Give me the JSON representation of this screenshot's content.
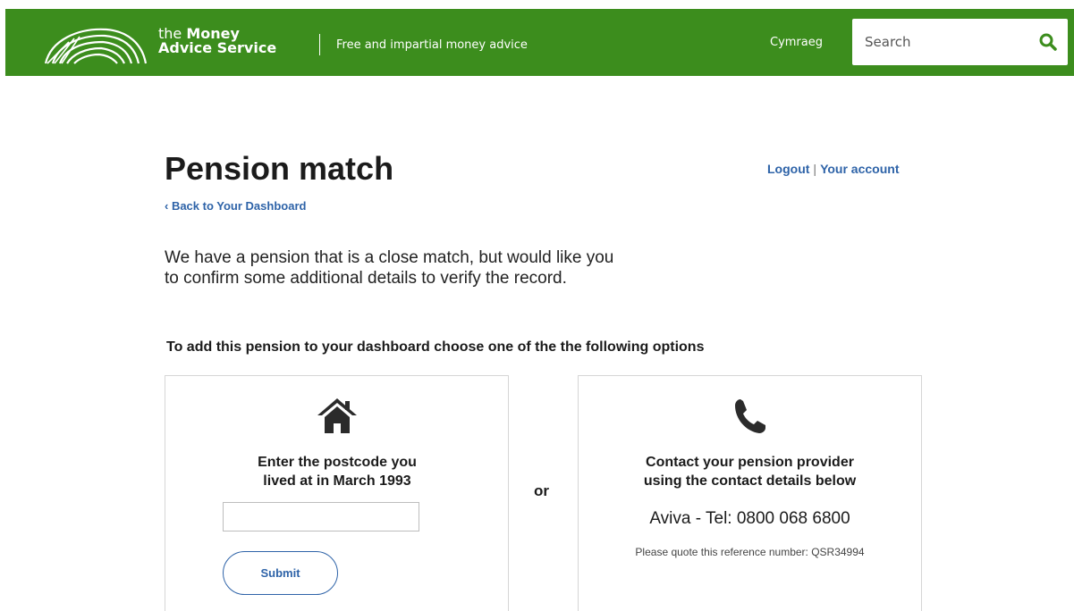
{
  "header": {
    "brand_prefix": "the ",
    "brand_bold": "Money",
    "brand_line2": "Advice Service",
    "tagline": "Free and impartial money advice",
    "language_link": "Cymraeg",
    "search": {
      "placeholder": "Search",
      "icon": "search-icon"
    },
    "colors": {
      "brand_green": "#3c8d1d"
    }
  },
  "page": {
    "title": "Pension match",
    "account_links": {
      "logout": "Logout",
      "separator": "|",
      "your_account": "Your account"
    },
    "back_link": "‹ Back to Your Dashboard",
    "intro_line1": "We have a pension that is a close match, but would like you",
    "intro_line2": "to confirm some additional details to verify the record.",
    "options_heading": "To add this pension to your dashboard choose one of the the following options",
    "or_text": "or"
  },
  "option_postcode": {
    "icon": "home-icon",
    "heading_line1": "Enter the postcode you",
    "heading_line2": "lived at in March 1993",
    "input_value": "",
    "submit_label": "Submit"
  },
  "option_contact": {
    "icon": "phone-icon",
    "heading_line1": "Contact your pension provider",
    "heading_line2": "using the contact details below",
    "contact_line": "Aviva - Tel: 0800 068 6800",
    "reference_line": "Please quote this reference number: QSR34994"
  },
  "colors": {
    "link_blue": "#2e63a8",
    "card_border": "#d6d6d6"
  }
}
